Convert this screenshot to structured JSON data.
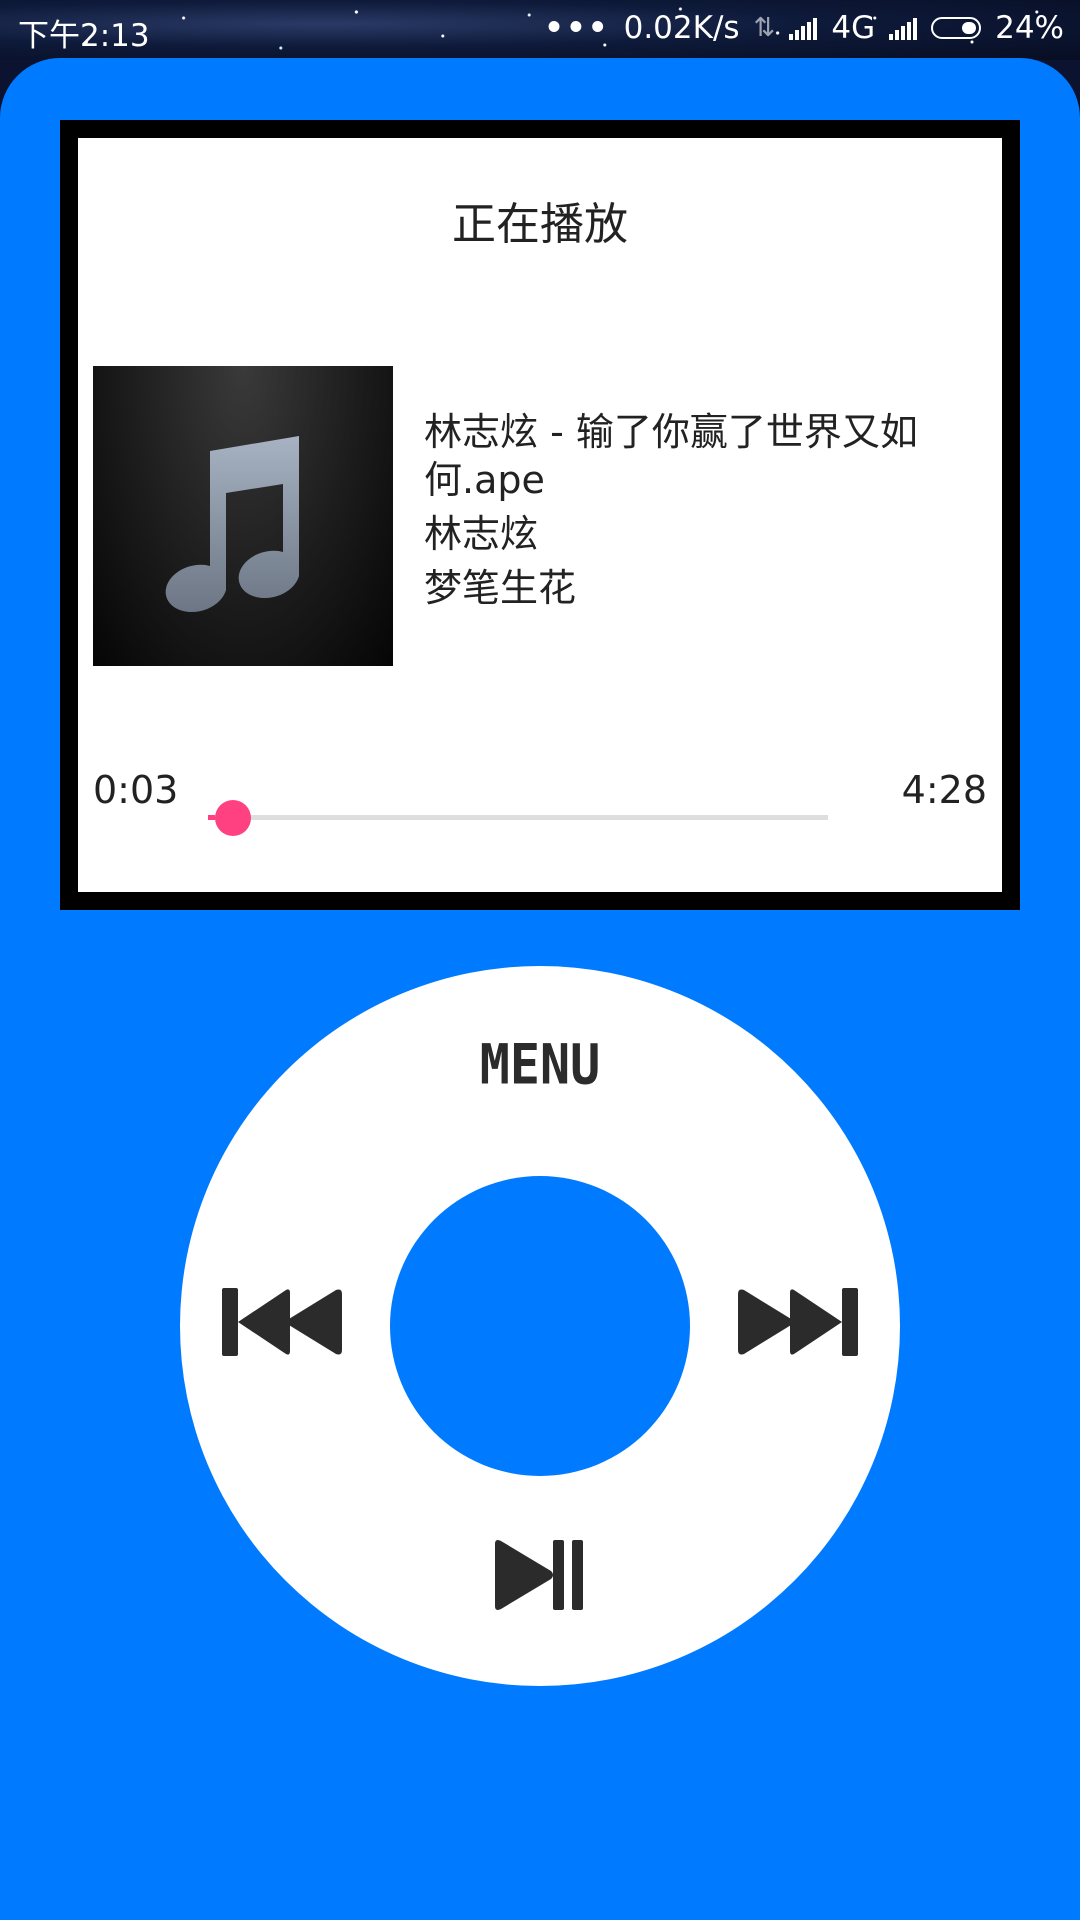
{
  "status_bar": {
    "time": "下午2:13",
    "dots": "•••",
    "net_speed": "0.02K/s",
    "network": "4G",
    "battery": "24%"
  },
  "player": {
    "screen_title": "正在播放",
    "song": {
      "title": "林志炫 - 输了你赢了世界又如何.ape",
      "artist": "林志炫",
      "album": "梦笔生花"
    },
    "current_time": "0:03",
    "total_time": "4:28",
    "progress_fraction": 0.012,
    "accent_color": "#ff4081"
  },
  "wheel": {
    "menu_label": "MENU",
    "prev_icon": "skip-previous-icon",
    "next_icon": "skip-next-icon",
    "playpause_icon": "play-pause-icon"
  },
  "colors": {
    "body": "#007bff",
    "screen_bezel": "#000000",
    "screen": "#ffffff",
    "wheel": "#ffffff",
    "icon": "#2b2b2b"
  }
}
